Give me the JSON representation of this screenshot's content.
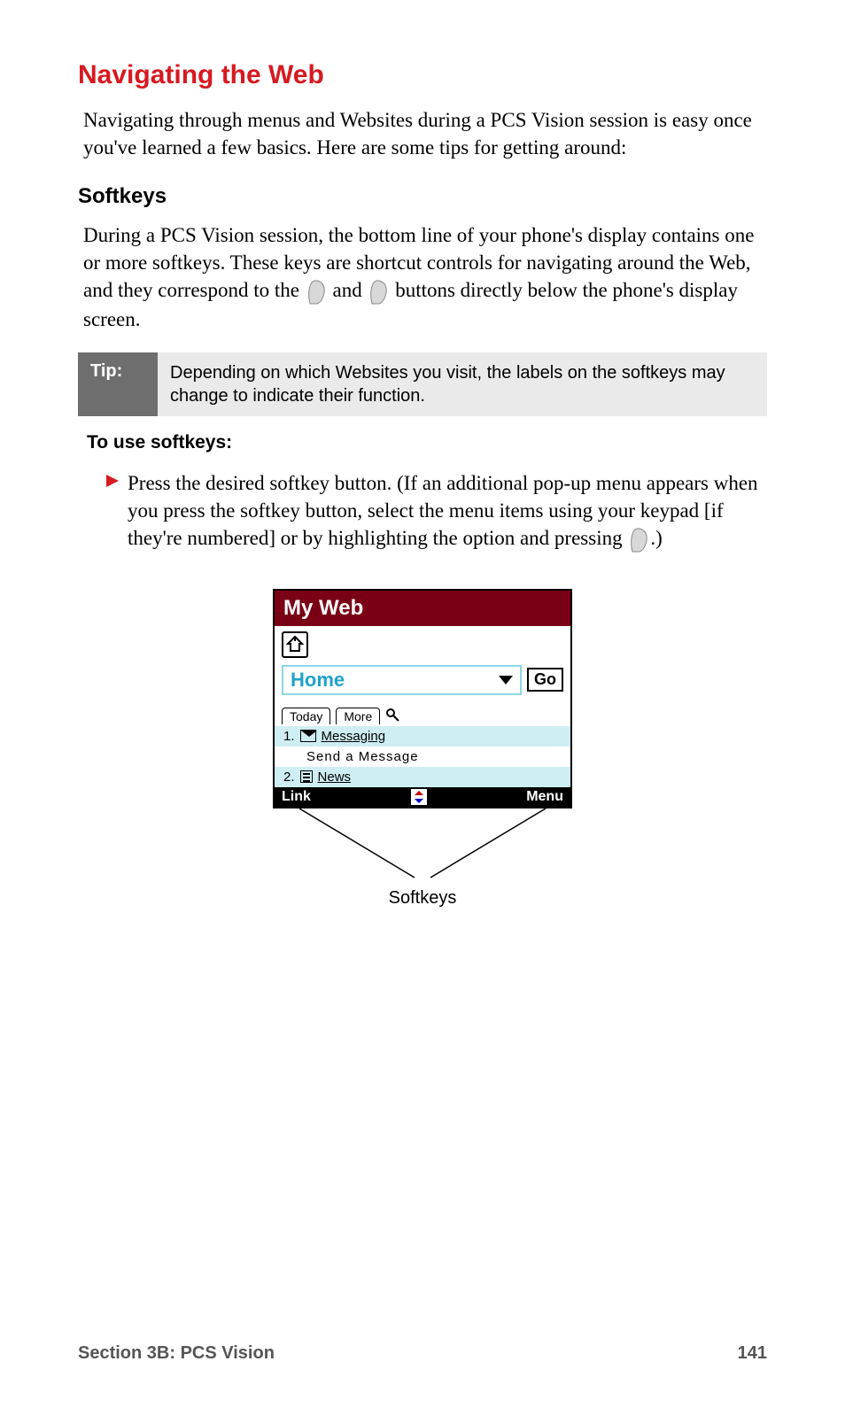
{
  "heading": "Navigating the Web",
  "intro": "Navigating through menus and Websites during a PCS Vision session is easy once you've learned a few basics. Here are some tips for getting around:",
  "softkeys_heading": "Softkeys",
  "softkeys_p1_a": "During a PCS Vision session, the bottom line of your phone's display contains one or more softkeys. These keys are shortcut controls for navigating around the Web, and they correspond to the ",
  "softkeys_p1_b": " and ",
  "softkeys_p1_c": " buttons directly below the phone's display screen.",
  "tip_label": "Tip:",
  "tip_body": "Depending on which Websites you visit, the labels on the softkeys may change to indicate their function.",
  "to_use": "To use softkeys:",
  "step_a": "Press the desired softkey button. (If an additional pop-up menu appears when you press the softkey button, select the menu items using your keypad [if they're numbered] or by highlighting the option and pressing ",
  "step_b": ".)",
  "phone": {
    "title": "My Web",
    "addr_value": "Home",
    "go": "Go",
    "tabs": {
      "today": "Today",
      "more": "More"
    },
    "rows": {
      "r1_num": "1.",
      "r1_label": "Messaging",
      "r1_sub": "Send a Message",
      "r2_num": "2.",
      "r2_label": "News"
    },
    "softkeys": {
      "left": "Link",
      "right": "Menu"
    }
  },
  "annotation_label": "Softkeys",
  "footer_left": "Section 3B: PCS Vision",
  "footer_right": "141"
}
